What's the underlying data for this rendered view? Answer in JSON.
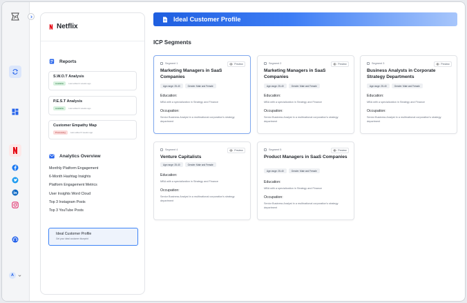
{
  "rail": {
    "icons": [
      "logo-icon",
      "refresh-icon",
      "dashboard-icon",
      "netflix-icon",
      "facebook-icon",
      "twitter-icon",
      "linkedin-icon",
      "instagram-icon",
      "support-icon"
    ],
    "avatar_letter": "A"
  },
  "sidebar": {
    "brand": "Netflix",
    "reports_title": "Reports",
    "reports": [
      {
        "title": "S.W.O.T Analysis",
        "status": "Available",
        "time": "Last edited 2 weeks ago"
      },
      {
        "title": "P.E.S.T Analysis",
        "status": "Available",
        "time": "Last edited 2 weeks ago"
      },
      {
        "title": "Customer Empathy Map",
        "status": "Processing",
        "time": "Last edited 3 weeks ago"
      }
    ],
    "analytics_title": "Analytics Overview",
    "analytics": [
      "Monthly Platform Engagement",
      "6-Month Hashtag Insights",
      "Platform Engagement Metrics",
      "User Insights Word Cloud",
      "Top 3 Instagram Posts",
      "Top 3 YouTube Posts"
    ],
    "icp_nav": {
      "title": "Ideal Customer Profile",
      "subtitle": "Get your ideal customer blueprint"
    }
  },
  "main": {
    "header": "Ideal Customer Profile",
    "section_title": "ICP Segments",
    "preview_label": "Preview",
    "education_label": "Education:",
    "occupation_label": "Occupation:",
    "segments": [
      {
        "segment": "Segment 1",
        "title": "Marketing Managers in SaaS Companies",
        "tags": [
          "Age range: 25-40",
          "Gender: Male and Female"
        ],
        "education": "MBA with a specialization in Strategy and Finance",
        "occupation": "Senior Business Analyst in a multinational corporation's strategy department"
      },
      {
        "segment": "Segment 2",
        "title": "Marketing Managers in SaaS Companies",
        "tags": [
          "Age range: 25-40",
          "Gender: Male and Female"
        ],
        "education": "MBA with a specialization in Strategy and Finance",
        "occupation": "Senior Business Analyst in a multinational corporation's strategy department"
      },
      {
        "segment": "Segment 3",
        "title": "Business Analysts in Corporate Strategy Departments",
        "tags": [
          "Age range: 25-40",
          "Gender: Male and Female"
        ],
        "education": "MBA with a specialization in Strategy and Finance",
        "occupation": "Senior Business Analyst in a multinational corporation's strategy department"
      },
      {
        "segment": "Segment 4",
        "title": "Venture Capitalists",
        "tags": [
          "Age range: 25-40",
          "Gender: Male and Female"
        ],
        "education": "MBA with a specialization in Strategy and Finance",
        "occupation": "Senior Business Analyst in a multinational corporation's strategy department"
      },
      {
        "segment": "Segment 5",
        "title": "Product Managers in SaaS Companies",
        "tags": [
          "Age range: 25-40",
          "Gender: Male and Female"
        ],
        "education": "MBA with a specialization in Strategy and Finance",
        "occupation": "Senior Business Analyst in a multinational corporation's strategy department"
      }
    ]
  },
  "colors": {
    "accent": "#2563eb",
    "netflix": "#e50914",
    "available": "#2a7a43",
    "processing": "#b33a3a"
  }
}
